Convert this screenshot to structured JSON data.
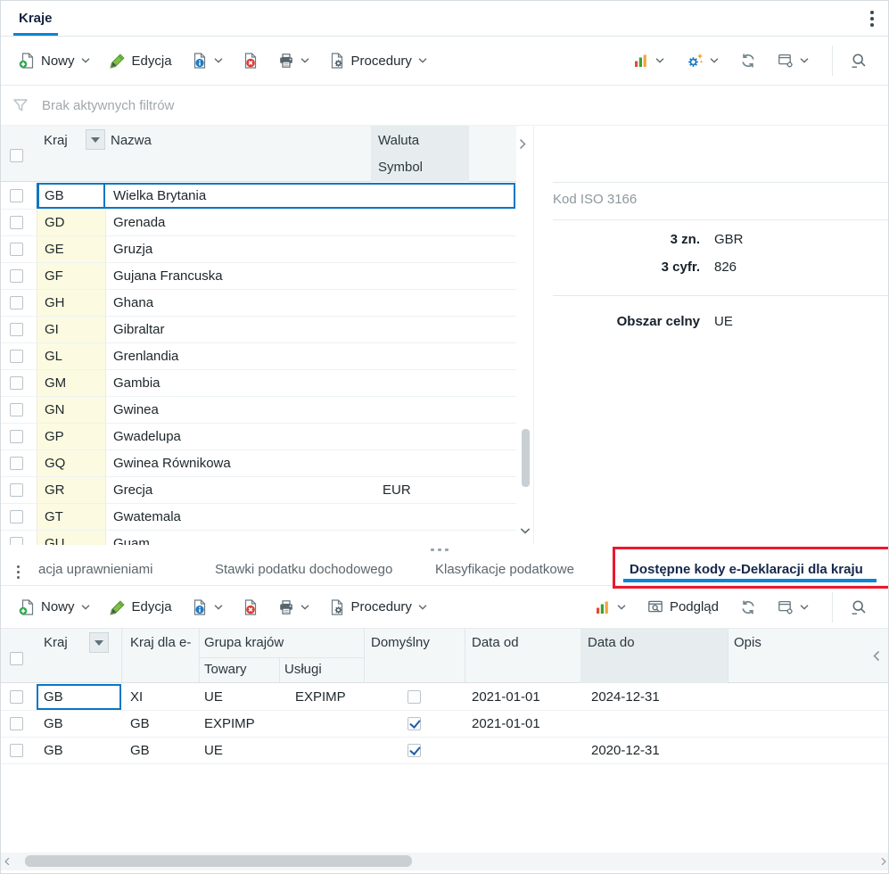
{
  "window": {
    "tab_label": "Kraje"
  },
  "toolbar": {
    "nowy": "Nowy",
    "edycja": "Edycja",
    "procedury": "Procedury",
    "podglad": "Podgląd"
  },
  "filter_bar": {
    "text": "Brak aktywnych filtrów"
  },
  "main_grid": {
    "columns": {
      "kraj": "Kraj",
      "nazwa": "Nazwa",
      "waluta": "Waluta",
      "symbol": "Symbol"
    },
    "rows": [
      {
        "kraj": "GB",
        "nazwa": "Wielka Brytania",
        "symbol": "",
        "selected": true
      },
      {
        "kraj": "GD",
        "nazwa": "Grenada",
        "symbol": ""
      },
      {
        "kraj": "GE",
        "nazwa": "Gruzja",
        "symbol": ""
      },
      {
        "kraj": "GF",
        "nazwa": "Gujana Francuska",
        "symbol": ""
      },
      {
        "kraj": "GH",
        "nazwa": "Ghana",
        "symbol": ""
      },
      {
        "kraj": "GI",
        "nazwa": "Gibraltar",
        "symbol": ""
      },
      {
        "kraj": "GL",
        "nazwa": "Grenlandia",
        "symbol": ""
      },
      {
        "kraj": "GM",
        "nazwa": "Gambia",
        "symbol": ""
      },
      {
        "kraj": "GN",
        "nazwa": "Gwinea",
        "symbol": ""
      },
      {
        "kraj": "GP",
        "nazwa": "Gwadelupa",
        "symbol": ""
      },
      {
        "kraj": "GQ",
        "nazwa": "Gwinea Równikowa",
        "symbol": ""
      },
      {
        "kraj": "GR",
        "nazwa": "Grecja",
        "symbol": "EUR"
      },
      {
        "kraj": "GT",
        "nazwa": "Gwatemala",
        "symbol": ""
      },
      {
        "kraj": "GU",
        "nazwa": "Guam",
        "symbol": ""
      }
    ]
  },
  "detail_panel": {
    "section_title": "Kod ISO 3166",
    "fields": [
      {
        "label": "3 zn.",
        "value": "GBR"
      },
      {
        "label": "3 cyfr.",
        "value": "826"
      }
    ],
    "area_field": {
      "label": "Obszar celny",
      "value": "UE"
    }
  },
  "bottom_tabs": {
    "tab0": "acja uprawnieniami",
    "tab1": "Stawki podatku dochodowego",
    "tab2": "Klasyfikacje podatkowe",
    "tab3": "Dostępne kody e-Deklaracji dla kraju"
  },
  "bottom_grid": {
    "columns": {
      "kraj": "Kraj",
      "kraj_dla_e": "Kraj dla e-",
      "grupa": "Grupa krajów",
      "towary": "Towary",
      "uslugi": "Usługi",
      "domyslny": "Domyślny",
      "data_od": "Data od",
      "data_do": "Data do",
      "opis": "Opis"
    },
    "rows": [
      {
        "kraj": "GB",
        "kraj_dla_e": "XI",
        "towary": "UE",
        "uslugi": "EXPIMP",
        "domyslny": false,
        "data_od": "2021-01-01",
        "data_do": "2024-12-31",
        "opis": "",
        "cell_focus": true
      },
      {
        "kraj": "GB",
        "kraj_dla_e": "GB",
        "towary": "EXPIMP",
        "uslugi": "",
        "domyslny": true,
        "data_od": "2021-01-01",
        "data_do": "",
        "opis": ""
      },
      {
        "kraj": "GB",
        "kraj_dla_e": "GB",
        "towary": "UE",
        "uslugi": "",
        "domyslny": true,
        "data_od": "",
        "data_do": "2020-12-31",
        "opis": ""
      }
    ]
  },
  "colors": {
    "accent_blue": "#0b76c2",
    "tab_underline": "#0b84d8",
    "annotation_red": "#e9192e",
    "kraj_column_yellow": "#fcfbe1",
    "header_bg": "#f3f7f8"
  }
}
